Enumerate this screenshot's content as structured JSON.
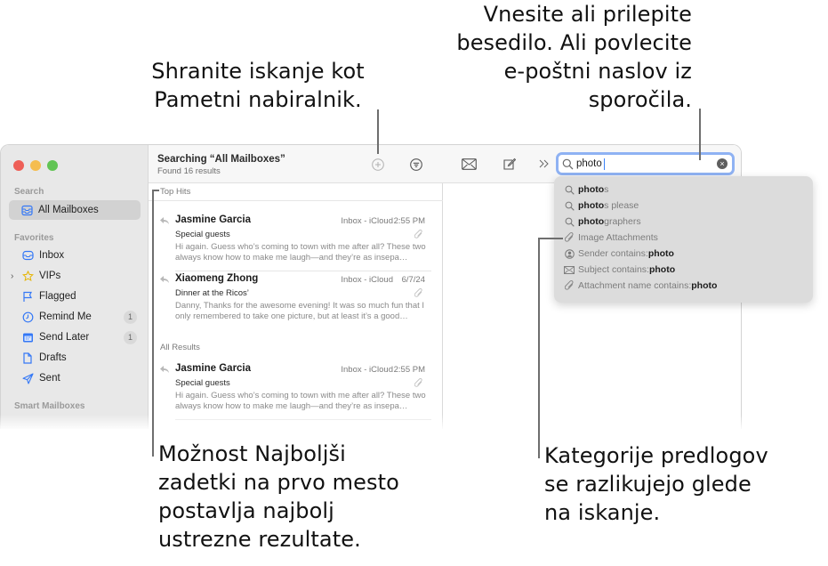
{
  "callouts": {
    "save_search": [
      "Shranite iskanje kot",
      "Pametni nabiralnik."
    ],
    "type_or_paste": [
      "Vnesite ali prilepite",
      "besedilo. Ali povlecite",
      "e-poštni naslov iz",
      "sporočila."
    ],
    "top_hits": [
      "Možnost Najboljši",
      "zadetki na prvo mesto",
      "postavlja najbolj",
      "ustrezne rezultate."
    ],
    "categories": [
      "Kategorije predlogov",
      "se razlikujejo glede",
      "na iskanje."
    ]
  },
  "window": {
    "traffic_lights": {
      "close": "#ee5f57",
      "minimize": "#f5bd4f",
      "zoom": "#61c454"
    }
  },
  "sidebar": {
    "search_section": "Search",
    "search_item": {
      "label": "All Mailboxes",
      "icon": "tray-stack-icon",
      "selected": true
    },
    "favorites_section": "Favorites",
    "favorites": [
      {
        "label": "Inbox",
        "icon": "inbox-icon",
        "badge": null
      },
      {
        "label": "VIPs",
        "icon": "star-icon",
        "badge": null,
        "expandable": true
      },
      {
        "label": "Flagged",
        "icon": "flag-icon",
        "badge": null
      },
      {
        "label": "Remind Me",
        "icon": "clock-icon",
        "badge": "1"
      },
      {
        "label": "Send Later",
        "icon": "calendar-icon",
        "badge": "1"
      },
      {
        "label": "Drafts",
        "icon": "document-icon",
        "badge": null
      },
      {
        "label": "Sent",
        "icon": "paperplane-icon",
        "badge": null
      }
    ],
    "smart_section": "Smart Mailboxes",
    "accent_color": "#3478f6",
    "star_color": "#f5c518"
  },
  "list": {
    "title": "Searching “All Mailboxes”",
    "subtitle": "Found 16 results",
    "top_hits_label": "Top Hits",
    "all_results_label": "All Results",
    "top_hits": [
      {
        "from": "Jasmine Garcia",
        "mailbox": "Inbox - iCloud",
        "time": "2:55 PM",
        "subject": "Special guests",
        "preview": "Hi again. Guess who’s coming to town with me after all? These two always know how to make me laugh—and they’re as insepa…",
        "attachment": true,
        "replied": true
      },
      {
        "from": "Xiaomeng Zhong",
        "mailbox": "Inbox - iCloud",
        "time": "6/7/24",
        "subject": "Dinner at the Ricos’",
        "preview": "Danny, Thanks for the awesome evening! It was so much fun that I only remembered to take one picture, but at least it’s a good…",
        "attachment": true,
        "replied": true
      }
    ],
    "all_results": [
      {
        "from": "Jasmine Garcia",
        "mailbox": "Inbox - iCloud",
        "time": "2:55 PM",
        "subject": "Special guests",
        "preview": "Hi again. Guess who’s coming to town with me after all? These two always know how to make me laugh—and they’re as insepa…",
        "attachment": true,
        "replied": true
      }
    ]
  },
  "toolbar": {
    "search_value": "photo",
    "search_focus_color": "#8fb2f3"
  },
  "suggestions": [
    {
      "icon": "search-icon",
      "match": "photo",
      "rest": "s",
      "kind": "completion"
    },
    {
      "icon": "search-icon",
      "match": "photo",
      "rest": "s please",
      "kind": "completion"
    },
    {
      "icon": "search-icon",
      "match": "photo",
      "rest": "graphers",
      "kind": "completion"
    },
    {
      "icon": "paperclip-icon",
      "label": "Image Attachments",
      "kind": "category"
    },
    {
      "icon": "person-circle-icon",
      "label": "Sender contains: ",
      "term": "photo",
      "kind": "field"
    },
    {
      "icon": "envelope-icon",
      "label": "Subject contains: ",
      "term": "photo",
      "kind": "field"
    },
    {
      "icon": "paperclip-icon",
      "label": "Attachment name contains: ",
      "term": "photo",
      "kind": "field"
    }
  ]
}
